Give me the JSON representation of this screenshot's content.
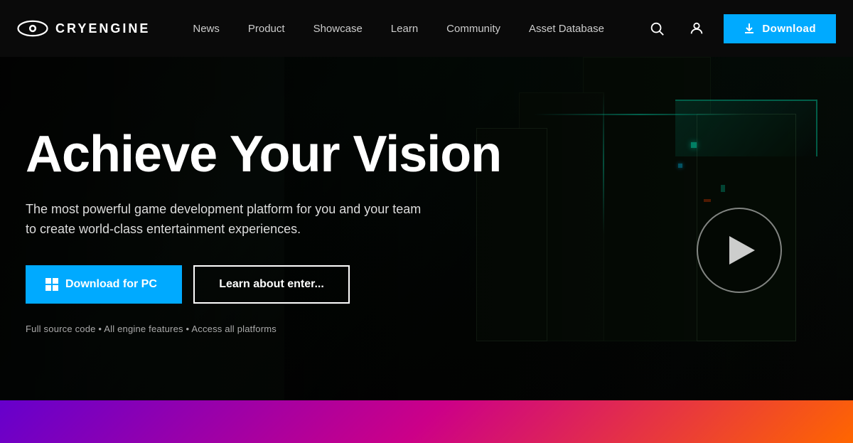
{
  "brand": {
    "name": "CRYENGINE",
    "logo_alt": "CryEngine logo"
  },
  "nav": {
    "links": [
      {
        "id": "news",
        "label": "News"
      },
      {
        "id": "product",
        "label": "Product"
      },
      {
        "id": "showcase",
        "label": "Showcase"
      },
      {
        "id": "learn",
        "label": "Learn"
      },
      {
        "id": "community",
        "label": "Community"
      },
      {
        "id": "asset-database",
        "label": "Asset Database"
      }
    ],
    "download_label": "Download"
  },
  "hero": {
    "title": "Achieve Your Vision",
    "subtitle_line1": "The most powerful game development platform for you and your team",
    "subtitle_line2": "to create world-class entertainment experiences.",
    "primary_button": "Download for PC",
    "secondary_button": "Learn about enter...",
    "features": "Full source code • All engine features • Access all platforms"
  },
  "colors": {
    "accent": "#00aaff",
    "download_bg": "#00aaff",
    "nav_bg": "#0a0a0a"
  }
}
